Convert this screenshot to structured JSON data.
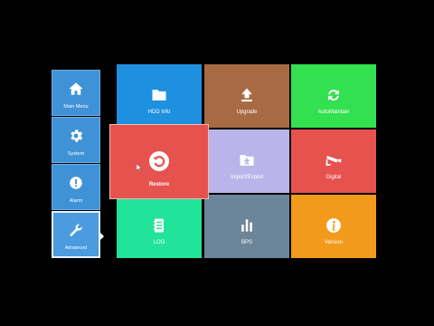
{
  "sidebar": {
    "items": [
      {
        "label": "Main Menu",
        "icon": "home-icon"
      },
      {
        "label": "System",
        "icon": "gear-icon"
      },
      {
        "label": "Alarm",
        "icon": "alarm-icon"
      },
      {
        "label": "Advanced",
        "icon": "wrench-icon"
      }
    ],
    "selected": "Advanced"
  },
  "tiles": [
    {
      "label": "HDD Info",
      "icon": "folder-icon",
      "color": "#1e90e0"
    },
    {
      "label": "Upgrade",
      "icon": "upload-arrow-icon",
      "color": "#a86a43"
    },
    {
      "label": "AutoMaintain",
      "icon": "refresh-icon",
      "color": "#33e04f"
    },
    {
      "label": "Import/Export",
      "icon": "folder-download-icon",
      "color": "#b9b5ea"
    },
    {
      "label": "Digital",
      "icon": "camera-icon",
      "color": "#e6524d"
    },
    {
      "label": "LOG",
      "icon": "log-icon",
      "color": "#22e39a"
    },
    {
      "label": "BPS",
      "icon": "bar-chart-icon",
      "color": "#6d8599"
    },
    {
      "label": "Version",
      "icon": "info-icon",
      "color": "#f29a1c"
    }
  ],
  "focused_tile": {
    "label": "Restore",
    "icon": "restore-icon",
    "color": "#e6524d"
  }
}
